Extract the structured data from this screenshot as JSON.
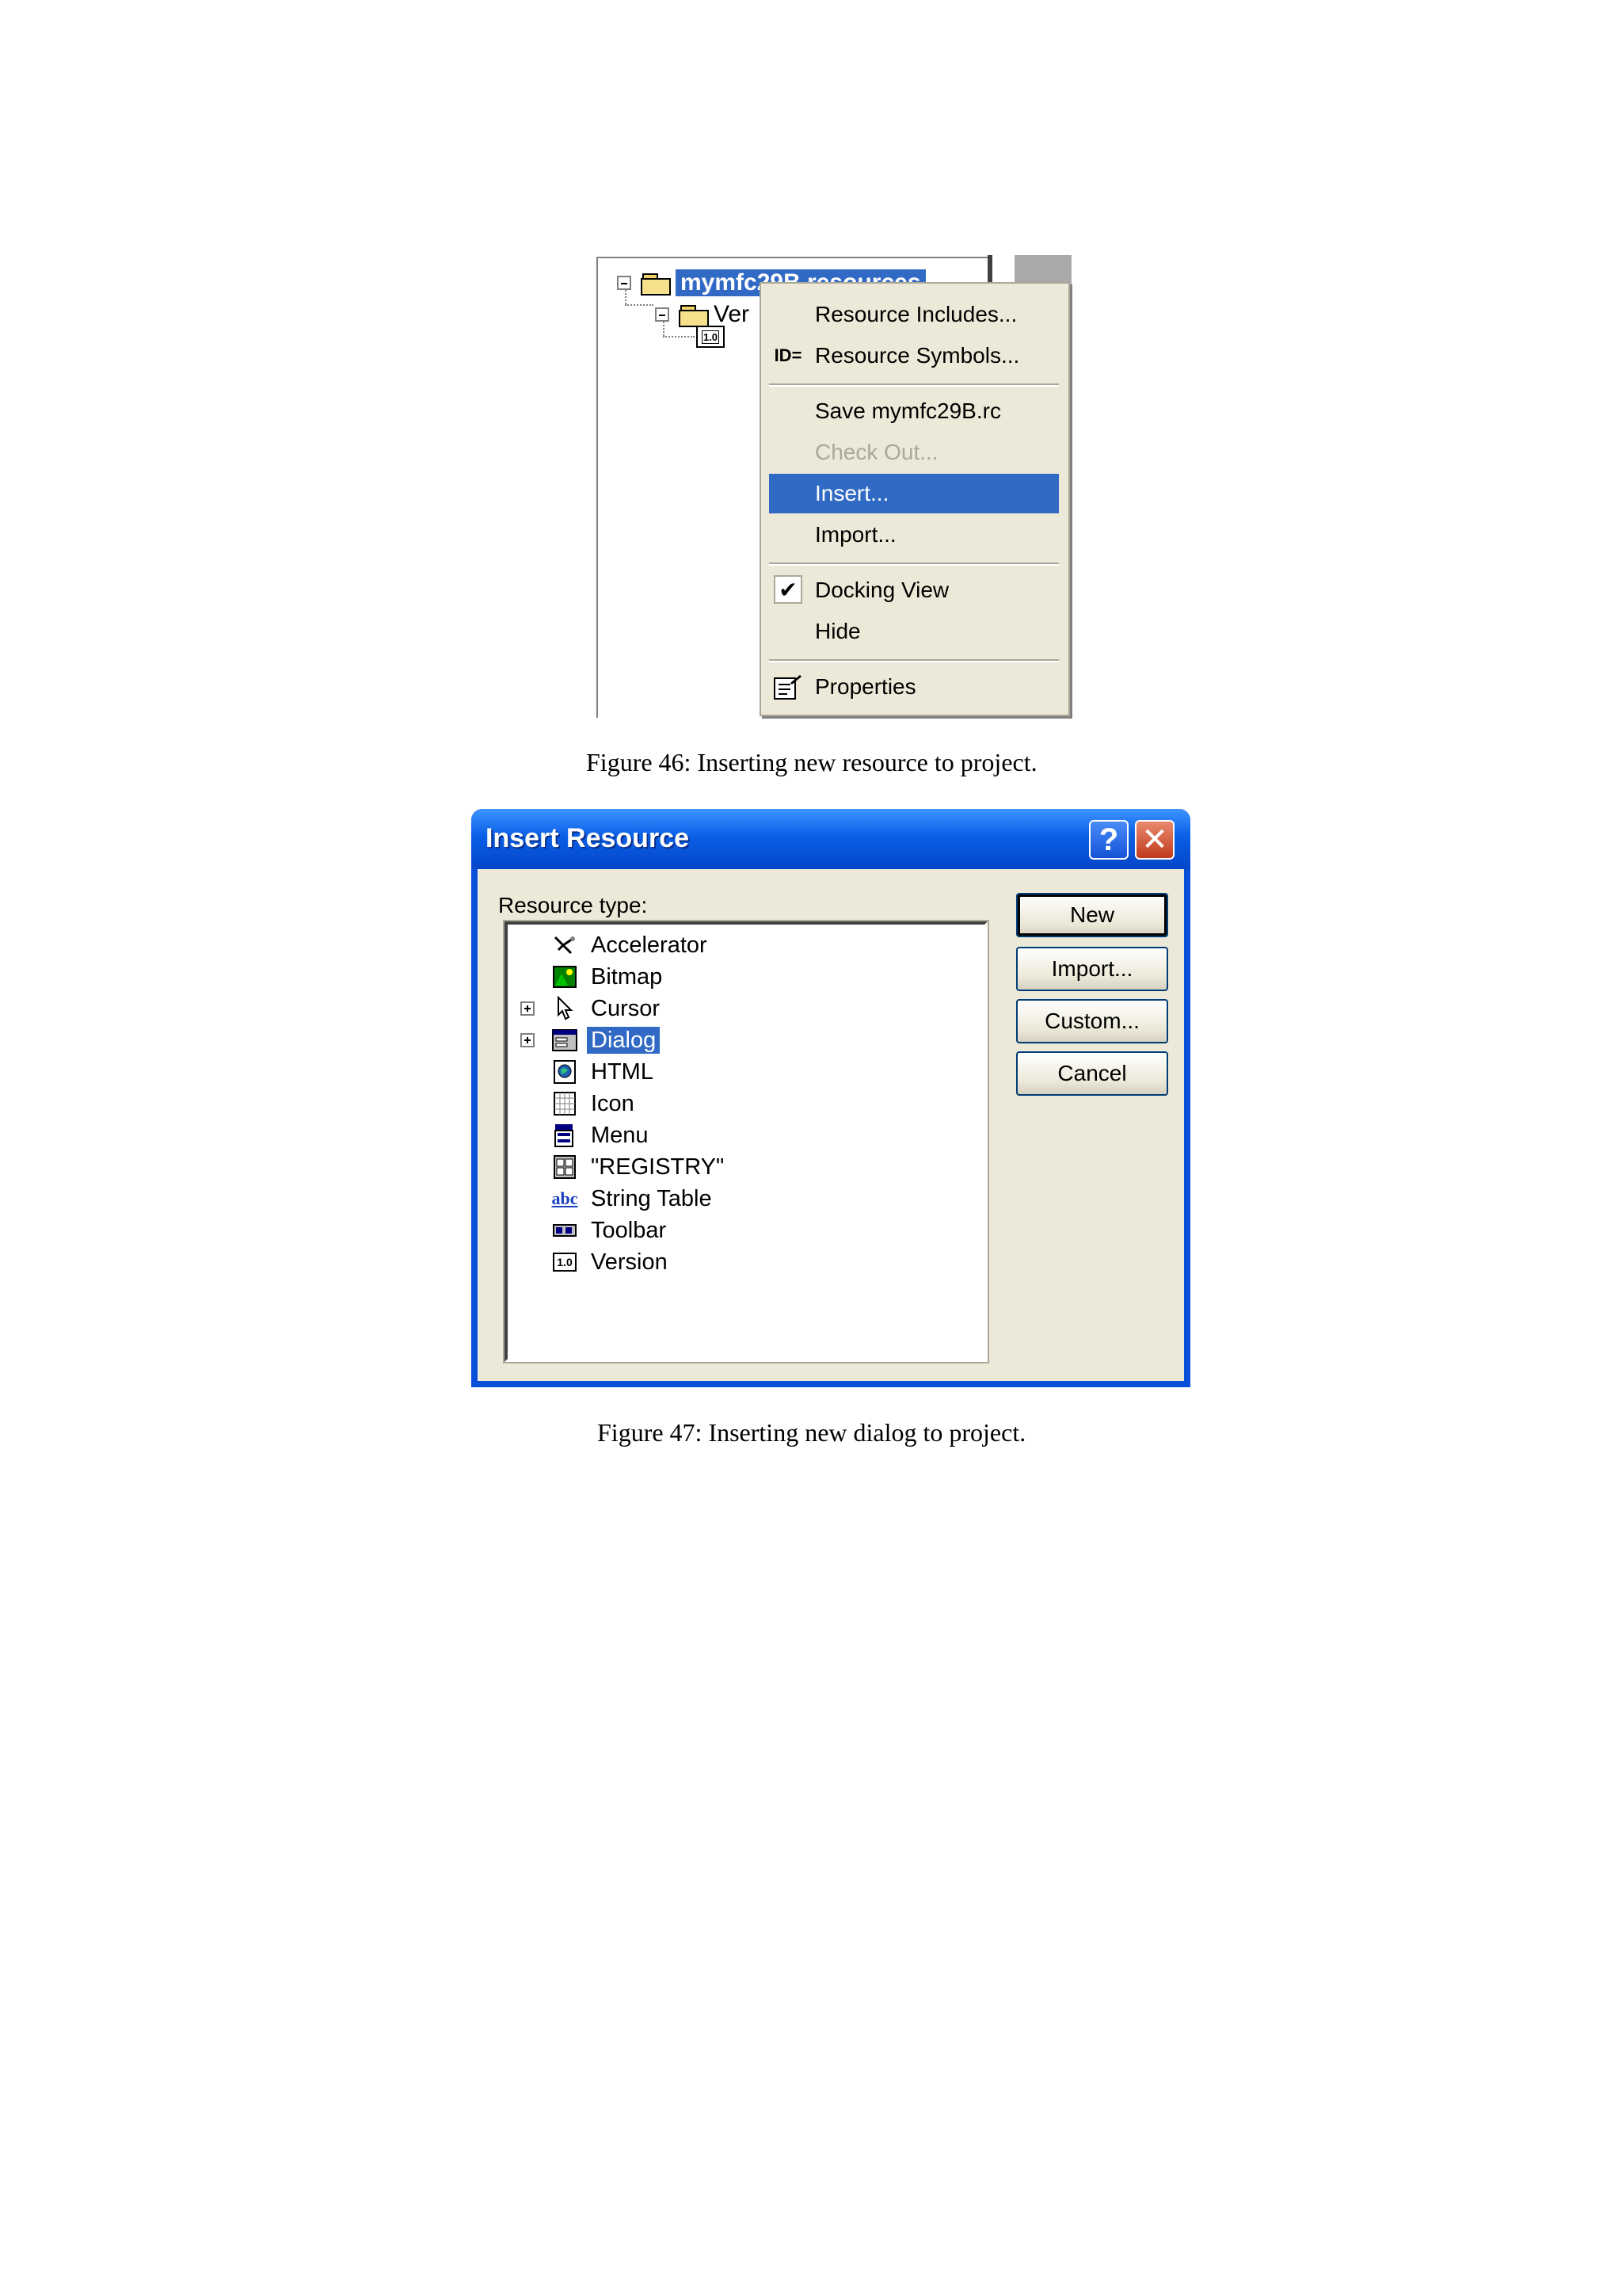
{
  "figure46": {
    "tree": {
      "root_label": "mymfc29B resources",
      "child_folder_label": "Ver",
      "version_icon_text": "1.0"
    },
    "context_menu": {
      "items": [
        {
          "label": "Resource Includes...",
          "icon": "none",
          "enabled": true
        },
        {
          "label": "Resource Symbols...",
          "icon": "id-equals-icon",
          "icon_text": "ID=",
          "enabled": true
        },
        {
          "label": "Save mymfc29B.rc",
          "icon": "none",
          "enabled": true
        },
        {
          "label": "Check Out...",
          "icon": "none",
          "enabled": false
        },
        {
          "label": "Insert...",
          "icon": "none",
          "enabled": true,
          "selected": true
        },
        {
          "label": "Import...",
          "icon": "none",
          "enabled": true
        },
        {
          "label": "Docking View",
          "icon": "check-icon",
          "checked": true,
          "enabled": true
        },
        {
          "label": "Hide",
          "icon": "none",
          "enabled": true
        },
        {
          "label": "Properties",
          "icon": "properties-icon",
          "enabled": true
        }
      ]
    },
    "caption": "Figure 46:  Inserting new resource to project."
  },
  "figure47": {
    "dialog": {
      "title": "Insert Resource",
      "help_glyph": "?",
      "close_glyph": "✕",
      "resource_type_label": "Resource type:",
      "resource_types": [
        {
          "label": "Accelerator",
          "icon": "accelerator-icon",
          "expandable": false
        },
        {
          "label": "Bitmap",
          "icon": "bitmap-icon",
          "expandable": false
        },
        {
          "label": "Cursor",
          "icon": "cursor-icon",
          "expandable": true
        },
        {
          "label": "Dialog",
          "icon": "dialog-icon",
          "expandable": true,
          "selected": true
        },
        {
          "label": "HTML",
          "icon": "html-icon",
          "expandable": false
        },
        {
          "label": "Icon",
          "icon": "icon-resource-icon",
          "expandable": false
        },
        {
          "label": "Menu",
          "icon": "menu-icon",
          "expandable": false
        },
        {
          "label": "\"REGISTRY\"",
          "icon": "registry-icon",
          "expandable": false
        },
        {
          "label": "String Table",
          "icon": "string-table-icon",
          "icon_text": "abc",
          "expandable": false
        },
        {
          "label": "Toolbar",
          "icon": "toolbar-icon",
          "expandable": false
        },
        {
          "label": "Version",
          "icon": "version-icon",
          "icon_text": "1.0",
          "expandable": false
        }
      ],
      "buttons": {
        "new": "New",
        "import": "Import...",
        "custom": "Custom...",
        "cancel": "Cancel"
      }
    },
    "caption": "Figure 47:  Inserting new dialog to project."
  },
  "colors": {
    "selection": "#316ac5",
    "xp_title_blue": "#0a5fe6",
    "dialog_face": "#ece9d8",
    "close_red": "#c23a1e",
    "disabled_text": "#aca899"
  }
}
